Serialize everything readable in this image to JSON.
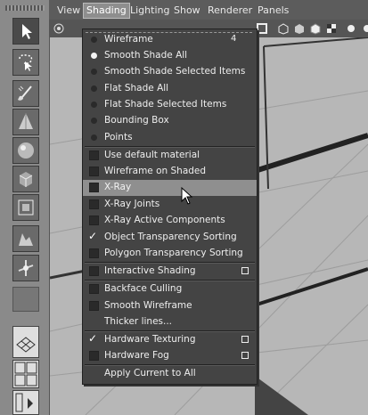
{
  "menubar": {
    "items": [
      "View",
      "Shading",
      "Lighting",
      "Show",
      "Renderer",
      "Panels"
    ],
    "active": "Shading"
  },
  "shading_menu": {
    "items": [
      {
        "label": "Wireframe",
        "kind": "radio",
        "checked": false,
        "shortcut": "4"
      },
      {
        "label": "Smooth Shade All",
        "kind": "radio",
        "checked": true
      },
      {
        "label": "Smooth Shade Selected Items",
        "kind": "radio",
        "checked": false
      },
      {
        "label": "Flat Shade All",
        "kind": "radio",
        "checked": false
      },
      {
        "label": "Flat Shade Selected Items",
        "kind": "radio",
        "checked": false
      },
      {
        "label": "Bounding Box",
        "kind": "radio",
        "checked": false
      },
      {
        "label": "Points",
        "kind": "radio",
        "checked": false
      },
      {
        "label": "Use default material",
        "kind": "check",
        "checked": false
      },
      {
        "label": "Wireframe on Shaded",
        "kind": "check",
        "checked": false
      },
      {
        "label": "X-Ray",
        "kind": "check",
        "checked": false,
        "highlighted": true
      },
      {
        "label": "X-Ray Joints",
        "kind": "check",
        "checked": false
      },
      {
        "label": "X-Ray Active Components",
        "kind": "check",
        "checked": false
      },
      {
        "label": "Object Transparency Sorting",
        "kind": "check",
        "checked": true
      },
      {
        "label": "Polygon Transparency Sorting",
        "kind": "check",
        "checked": false
      },
      {
        "label": "Interactive Shading",
        "kind": "check",
        "checked": false,
        "option_box": true
      },
      {
        "label": "Backface Culling",
        "kind": "check",
        "checked": false
      },
      {
        "label": "Smooth Wireframe",
        "kind": "check",
        "checked": false
      },
      {
        "label": "Thicker lines...",
        "kind": "plain"
      },
      {
        "label": "Hardware Texturing",
        "kind": "check",
        "checked": true,
        "option_box": true
      },
      {
        "label": "Hardware Fog",
        "kind": "check",
        "checked": false,
        "option_box": true
      },
      {
        "label": "Apply Current to All",
        "kind": "plain"
      }
    ]
  },
  "colors": {
    "menu_bg": "#444444",
    "highlight": "#8f8f8f",
    "menubar_bg": "#5c5c5c",
    "viewport_bg": "#b9b9b9"
  }
}
